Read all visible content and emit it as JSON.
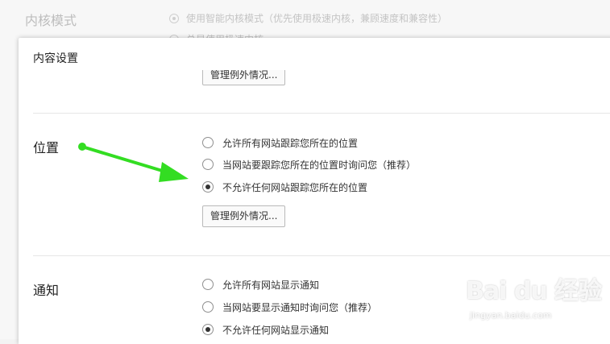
{
  "background": {
    "section_label": "内核模式",
    "option_1": "使用智能内核模式（优先使用极速内核，兼顾速度和兼容性）",
    "option_2": "总是使用极速内核"
  },
  "dialog": {
    "title": "内容设置",
    "top_manage_button": "管理例外情况...",
    "location": {
      "label": "位置",
      "options": [
        {
          "label": "允许所有网站跟踪您所在的位置",
          "checked": false
        },
        {
          "label": "当网站要跟踪您所在的位置时询问您（推荐）",
          "checked": false
        },
        {
          "label": "不允许任何网站跟踪您所在的位置",
          "checked": true
        }
      ],
      "manage_button": "管理例外情况..."
    },
    "notifications": {
      "label": "通知",
      "options": [
        {
          "label": "允许所有网站显示通知",
          "checked": false
        },
        {
          "label": "当网站要显示通知时询问您（推荐）",
          "checked": false
        },
        {
          "label": "不允许任何网站显示通知",
          "checked": true
        }
      ]
    }
  },
  "annotation": {
    "arrow_color": "#33dd22"
  },
  "watermark": {
    "main": "Bai du 经验",
    "sub": "jingyan.baidu.com"
  }
}
